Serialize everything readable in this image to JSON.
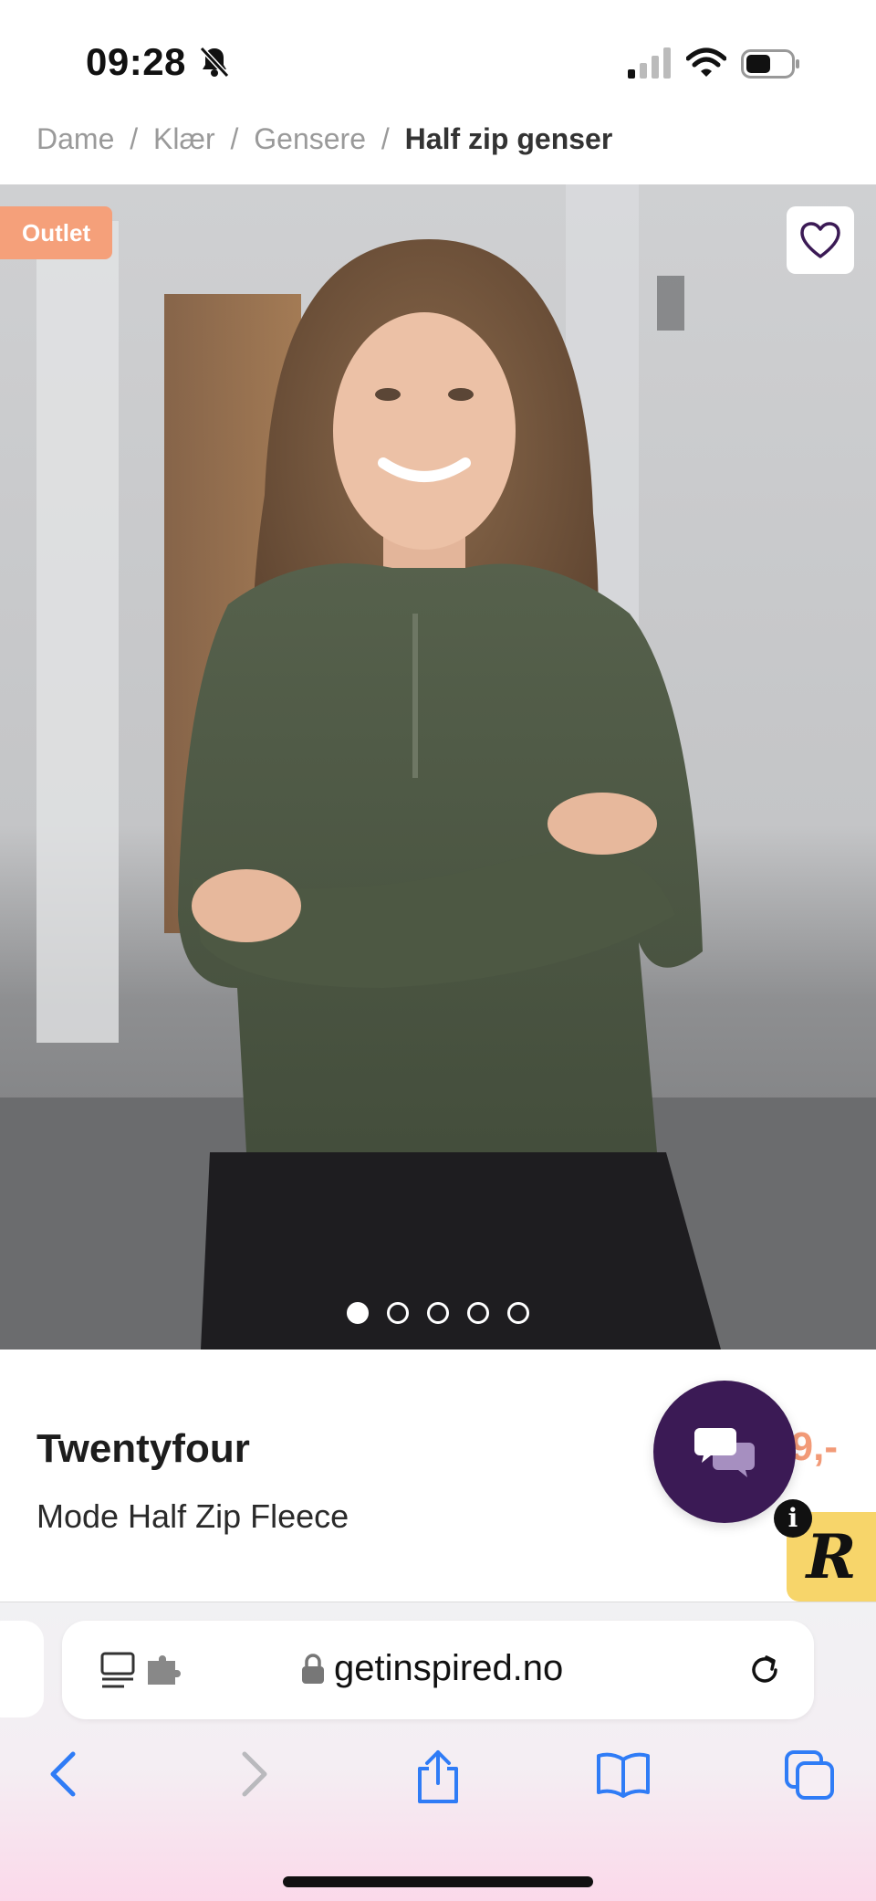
{
  "status_bar": {
    "time": "09:28"
  },
  "breadcrumb": {
    "items": [
      "Dame",
      "Klær",
      "Gensere"
    ],
    "current": "Half zip genser",
    "separator": "/"
  },
  "hero": {
    "badge": "Outlet",
    "image_count": 5,
    "active_image": 1
  },
  "product": {
    "brand": "Twentyfour",
    "name": "Mode Half Zip Fleece",
    "price_visible": "9,-"
  },
  "browser": {
    "url": "getinspired.no"
  },
  "colors": {
    "badge": "#f5a07a",
    "chat": "#3b1a55",
    "price": "#f29a77",
    "ios_blue": "#2f7cf6",
    "r_badge": "#f7d56a"
  }
}
